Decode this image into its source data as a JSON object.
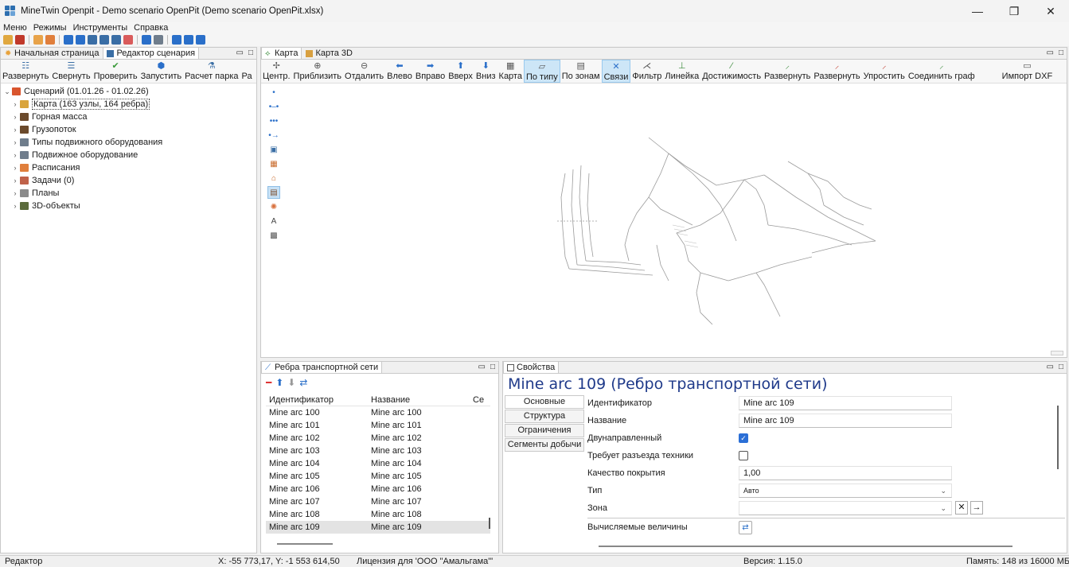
{
  "window": {
    "title": "MineTwin Openpit - Demo scenario OpenPit (Demo scenario OpenPit.xlsx)",
    "minimize": "—",
    "restore": "❐",
    "close": "✕"
  },
  "menu": [
    "Меню",
    "Режимы",
    "Инструменты",
    "Справка"
  ],
  "left_panel": {
    "tabs": [
      {
        "label": "Начальная страница",
        "icon": "start-icon"
      },
      {
        "label": "Редактор сценария",
        "icon": "scenario-icon"
      }
    ],
    "buttons": [
      {
        "label": "Развернуть",
        "icon": "expand-icon"
      },
      {
        "label": "Свернуть",
        "icon": "collapse-icon"
      },
      {
        "label": "Проверить",
        "icon": "check-icon"
      },
      {
        "label": "Запустить",
        "icon": "run-icon"
      },
      {
        "label": "Расчет парка",
        "icon": "fleet-calc-icon"
      },
      {
        "label": "Ра",
        "icon": "more-icon"
      }
    ],
    "tree": {
      "root": {
        "label": "Сценарий (01.01.26 - 01.02.26)",
        "chevron": "⌄"
      },
      "items": [
        {
          "label": "Карта (163 узлы, 164 ребра)",
          "color": "#d9a43c",
          "focused": true
        },
        {
          "label": "Горная масса",
          "color": "#6b4a2c"
        },
        {
          "label": "Грузопоток",
          "color": "#6b4a2c"
        },
        {
          "label": "Типы подвижного оборудования",
          "color": "#6f7d8c"
        },
        {
          "label": "Подвижное оборудование",
          "color": "#6f7d8c"
        },
        {
          "label": "Расписания",
          "color": "#e07f3c"
        },
        {
          "label": "Задачи (0)",
          "color": "#c0624a"
        },
        {
          "label": "Планы",
          "color": "#8a8a8a"
        },
        {
          "label": "3D-объекты",
          "color": "#5b6b3c"
        }
      ],
      "chevron": "›"
    }
  },
  "map_panel": {
    "tabs": [
      {
        "label": "Карта",
        "icon": "map-icon"
      },
      {
        "label": "Карта 3D",
        "icon": "map3d-icon"
      }
    ],
    "buttons": [
      {
        "label": "Центр.",
        "glyph": "✢",
        "color": "#555"
      },
      {
        "label": "Приблизить",
        "glyph": "⊕",
        "color": "#555"
      },
      {
        "label": "Отдалить",
        "glyph": "⊖",
        "color": "#555"
      },
      {
        "label": "Влево",
        "glyph": "⬅",
        "color": "#2a6fc9"
      },
      {
        "label": "Вправо",
        "glyph": "➡",
        "color": "#2a6fc9"
      },
      {
        "label": "Вверх",
        "glyph": "⬆",
        "color": "#2a6fc9"
      },
      {
        "label": "Вниз",
        "glyph": "⬇",
        "color": "#2a6fc9"
      },
      {
        "label": "Карта",
        "glyph": "▦",
        "color": "#555"
      },
      {
        "label": "По типу",
        "glyph": "▱",
        "color": "#555",
        "selected": true
      },
      {
        "label": "По зонам",
        "glyph": "▤",
        "color": "#555"
      },
      {
        "label": "Связи",
        "glyph": "✕",
        "color": "#2a6fc9",
        "selected": true
      },
      {
        "label": "Фильтр",
        "glyph": "⋌",
        "color": "#555"
      },
      {
        "label": "Линейка",
        "glyph": "⊥",
        "color": "#3a8a3a"
      },
      {
        "label": "Достижимость",
        "glyph": "⁄",
        "color": "#3a8a3a"
      },
      {
        "label": "Развернуть",
        "glyph": "⸝",
        "color": "#3a8a3a"
      },
      {
        "label": "Развернуть",
        "glyph": "⸝",
        "color": "#c0392b"
      },
      {
        "label": "Упростить",
        "glyph": "⸝",
        "color": "#c0392b"
      },
      {
        "label": "Соединить граф",
        "glyph": "⸝",
        "color": "#3a8a3a"
      },
      {
        "label": "Импорт DXF",
        "glyph": "▭",
        "color": "#555"
      }
    ],
    "side_tools": [
      {
        "glyph": "•",
        "name": "point-tool-icon",
        "color": "#2a6fc9"
      },
      {
        "glyph": "•–•",
        "name": "edge-tool-icon",
        "color": "#2a6fc9"
      },
      {
        "glyph": "•••",
        "name": "polyline-tool-icon",
        "color": "#2a6fc9"
      },
      {
        "glyph": "•→",
        "name": "directed-edge-tool-icon",
        "color": "#2a6fc9"
      },
      {
        "glyph": "▣",
        "name": "station-tool-icon",
        "color": "#3a6ea5"
      },
      {
        "glyph": "▦",
        "name": "loading-tool-icon",
        "color": "#c86a2a"
      },
      {
        "glyph": "⌂",
        "name": "factory-tool-icon",
        "color": "#c86a2a"
      },
      {
        "glyph": "▤",
        "name": "unloading-tool-icon",
        "color": "#7a4a2a",
        "selected": true
      },
      {
        "glyph": "✺",
        "name": "zone-tool-icon",
        "color": "#d8703c"
      },
      {
        "glyph": "A",
        "name": "text-tool-icon",
        "color": "#444"
      },
      {
        "glyph": "▩",
        "name": "object-tool-icon",
        "color": "#555"
      }
    ]
  },
  "edges_panel": {
    "title": "Ребра транспортной сети",
    "toolbar": [
      {
        "glyph": "━",
        "name": "remove-icon",
        "color": "#d33"
      },
      {
        "glyph": "⬆",
        "name": "move-up-icon",
        "color": "#2a6fc9"
      },
      {
        "glyph": "⬇",
        "name": "move-down-icon",
        "color": "#999"
      },
      {
        "glyph": "⇄",
        "name": "refresh-icon",
        "color": "#2a6fc9"
      }
    ],
    "columns": [
      "Идентификатор",
      "Название",
      "Се"
    ],
    "rows": [
      {
        "id": "Mine arc 100",
        "name": "Mine arc 100"
      },
      {
        "id": "Mine arc 101",
        "name": "Mine arc 101"
      },
      {
        "id": "Mine arc 102",
        "name": "Mine arc 102"
      },
      {
        "id": "Mine arc 103",
        "name": "Mine arc 103"
      },
      {
        "id": "Mine arc 104",
        "name": "Mine arc 104"
      },
      {
        "id": "Mine arc 105",
        "name": "Mine arc 105"
      },
      {
        "id": "Mine arc 106",
        "name": "Mine arc 106"
      },
      {
        "id": "Mine arc 107",
        "name": "Mine arc 107"
      },
      {
        "id": "Mine arc 108",
        "name": "Mine arc 108"
      },
      {
        "id": "Mine arc 109",
        "name": "Mine arc 109",
        "selected": true
      }
    ]
  },
  "props_panel": {
    "tab": "Свойства",
    "heading": "Mine arc 109 (Ребро транспортной сети)",
    "side_tabs": [
      "Основные",
      "Структура",
      "Ограничения",
      "Сегменты добычи"
    ],
    "fields": {
      "id_label": "Идентификатор",
      "id_value": "Mine arc 109",
      "name_label": "Название",
      "name_value": "Mine arc 109",
      "bidir_label": "Двунаправленный",
      "bidir_checked": true,
      "pass_label": "Требует разъезда техники",
      "pass_checked": false,
      "coverage_label": "Качество покрытия",
      "coverage_value": "1,00",
      "type_label": "Тип",
      "type_value": "Авто",
      "zone_label": "Зона",
      "zone_value": "",
      "calc_label": "Вычисляемые величины"
    }
  },
  "status": {
    "mode": "Редактор",
    "coords": "X: -55 773,17, Y: -1 553 614,50",
    "license": "Лицензия для 'ООО \"Амальгама\"'",
    "version": "Версия: 1.15.0",
    "memory": "Память: 148 из 16000 МБ"
  }
}
